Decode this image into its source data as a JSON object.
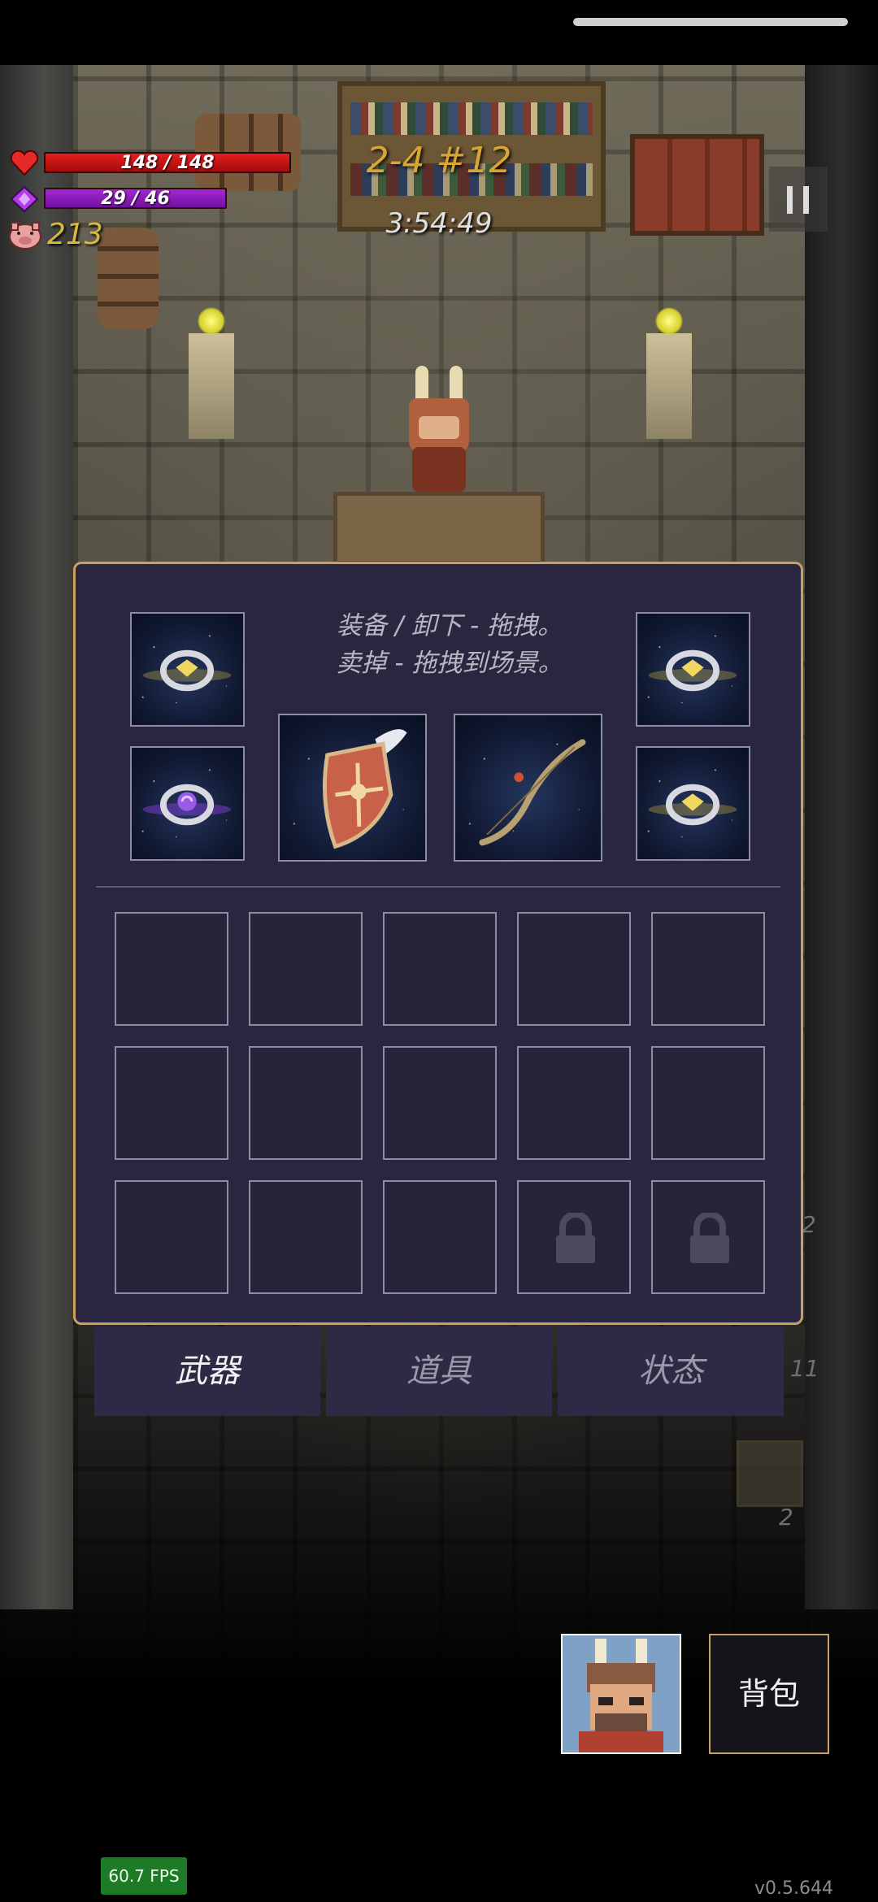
{
  "hud": {
    "hp": "148 / 148",
    "mp": "29 / 46",
    "coins": "213",
    "stage": "2-4 #12",
    "timer": "3:54:49"
  },
  "inventory": {
    "hint_line1": "装备 / 卸下 - 拖拽。",
    "hint_line2": "卖掉 - 拖拽到场景。",
    "equipped": [
      {
        "icon": "gold-ring-icon"
      },
      {
        "icon": "gold-ring-icon"
      },
      {
        "icon": "purple-gem-ring-icon"
      },
      {
        "icon": "winged-shield-icon"
      },
      {
        "icon": "bow-icon"
      },
      {
        "icon": "gold-ring-icon"
      }
    ],
    "grid_rows": 3,
    "grid_cols": 5,
    "locked_slots": 2
  },
  "tabs": {
    "weapons": "武器",
    "items": "道具",
    "status": "状态"
  },
  "side_counters": {
    "a": "2",
    "b": "11",
    "c": "2"
  },
  "backpack_label": "背包",
  "fps": "60.7 FPS",
  "version": "v0.5.644",
  "colors": {
    "panel_bg": "#2a2640",
    "panel_border": "#c9a060",
    "hp": "#e61e1e",
    "mp": "#a528d4",
    "coin": "#d8b840"
  }
}
